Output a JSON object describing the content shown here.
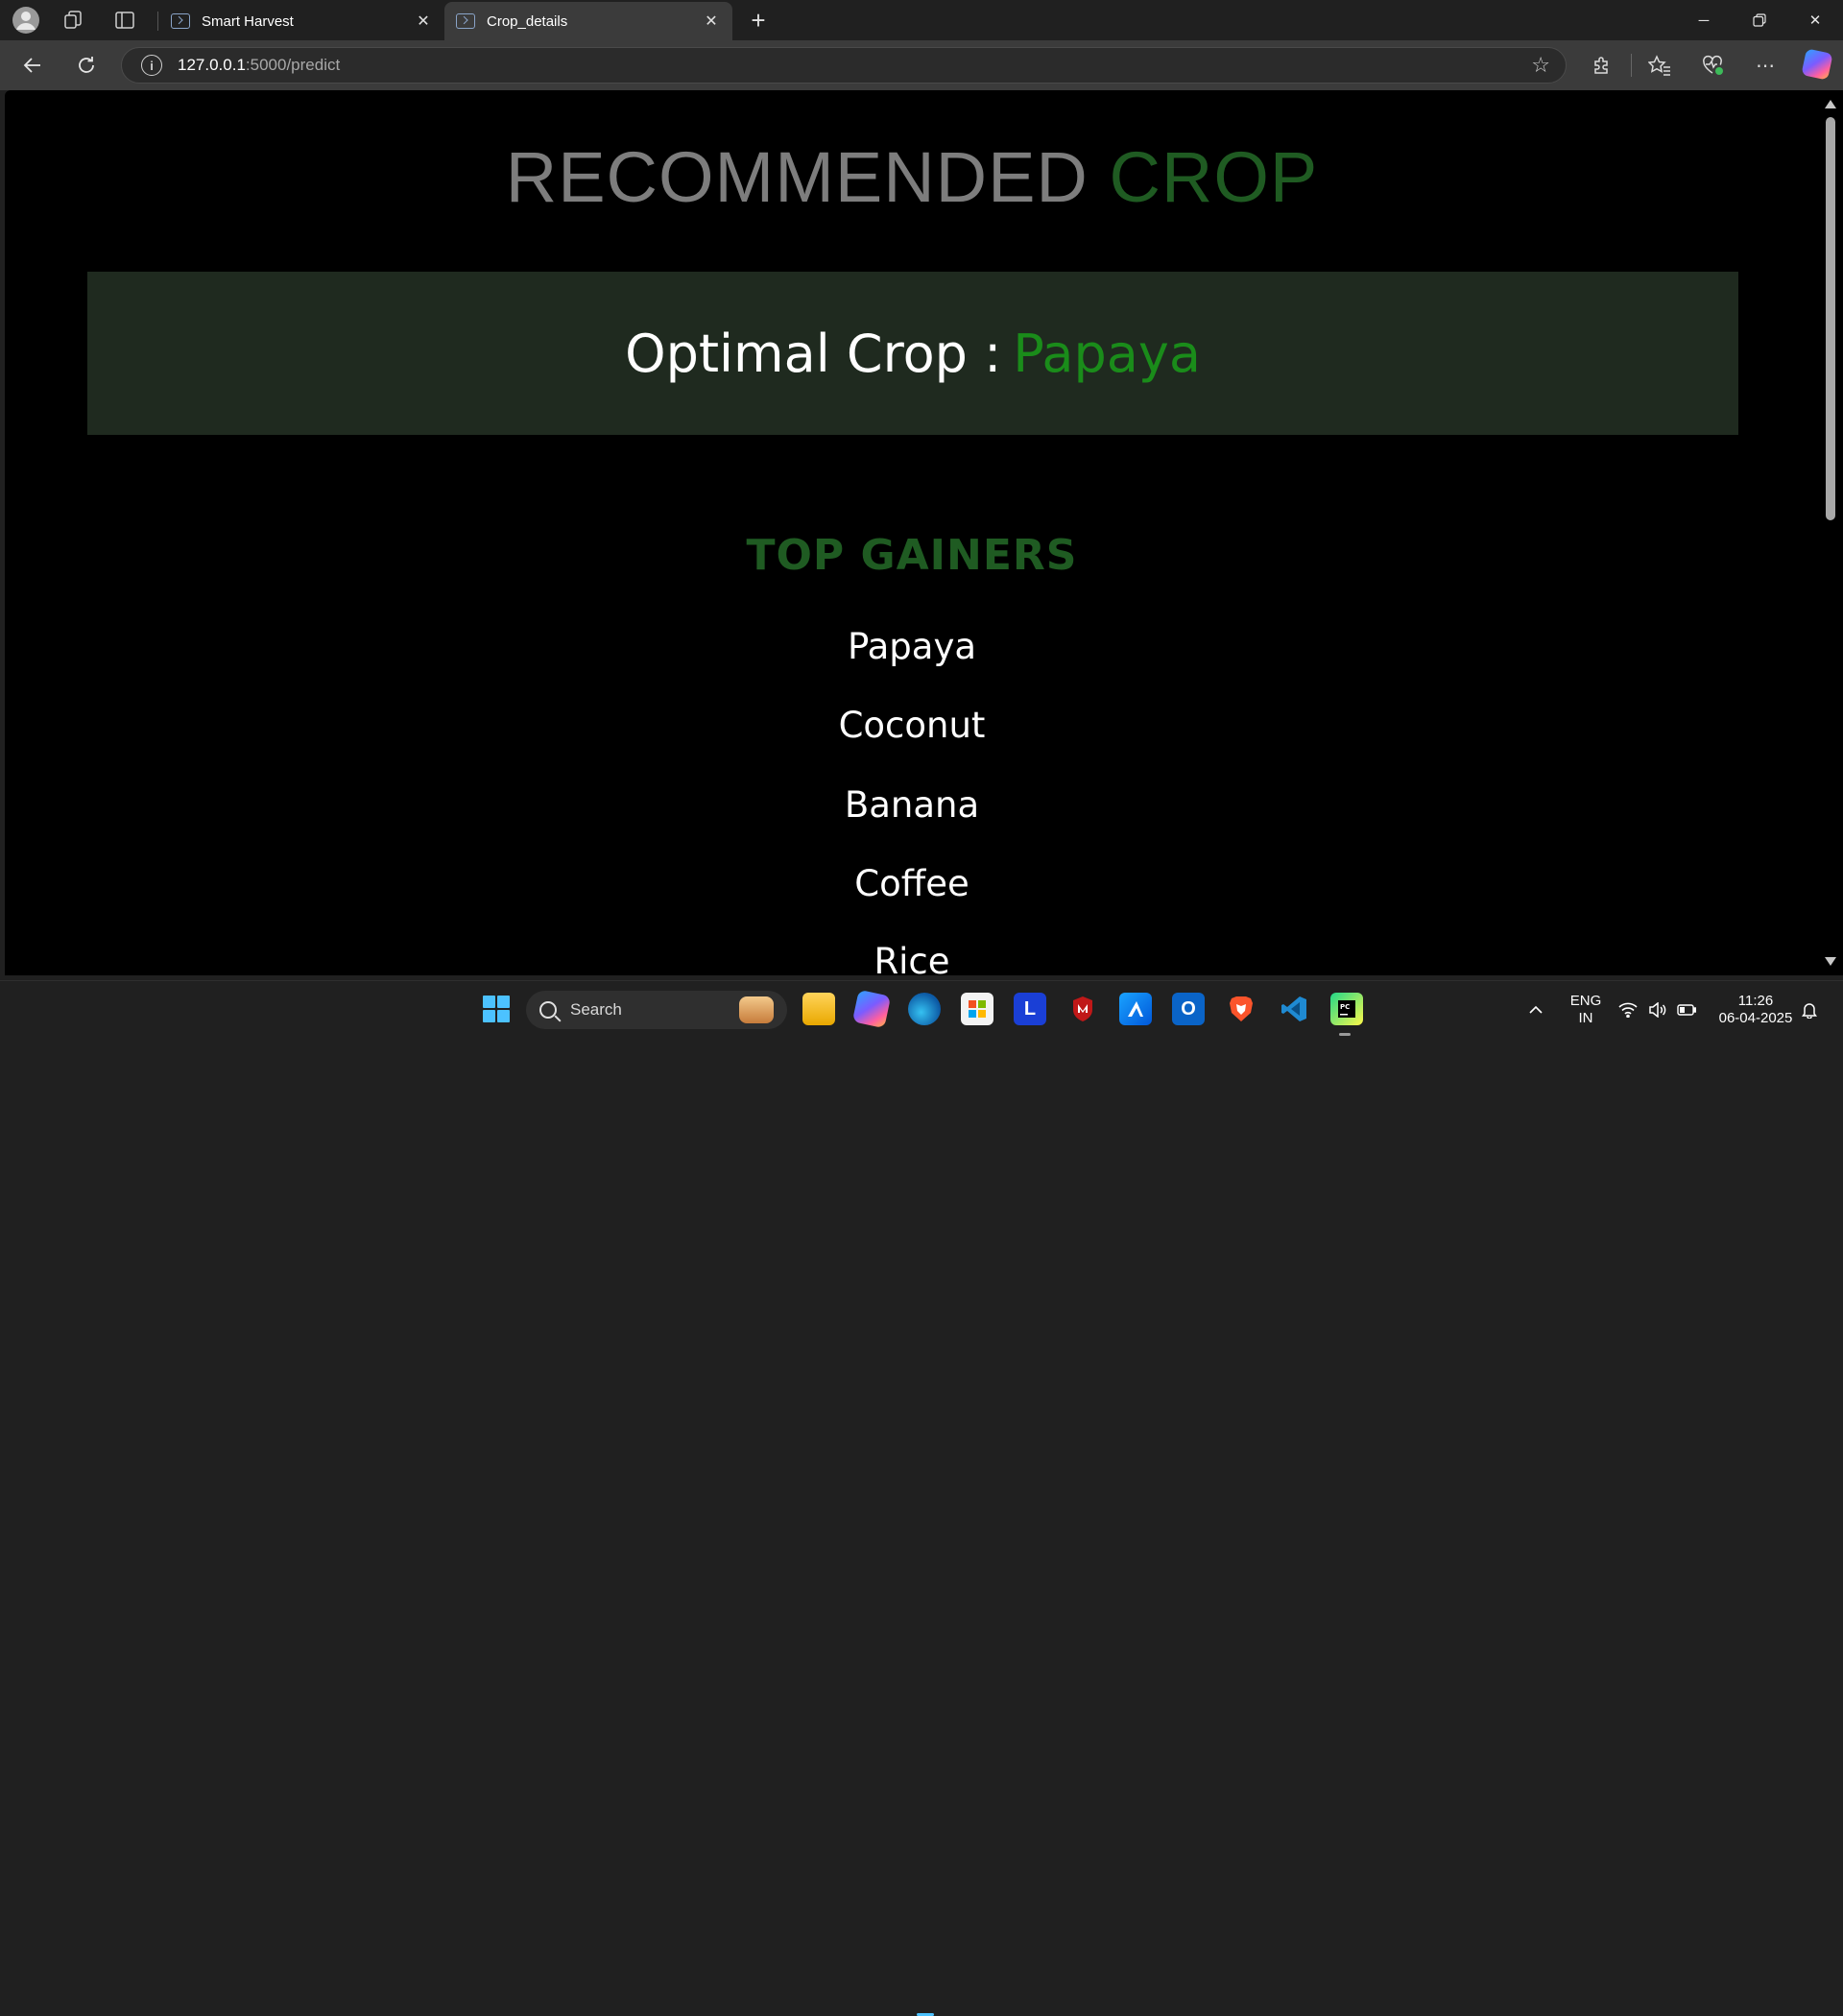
{
  "browser": {
    "tabs": [
      {
        "label": "Smart Harvest",
        "active": false
      },
      {
        "label": "Crop_details",
        "active": true
      }
    ],
    "url_host": "127.0.0.1",
    "url_rest": ":5000/predict"
  },
  "page": {
    "title_part1": "RECOMMENDED",
    "title_part2": "CROP",
    "optimal_label": "Optimal Crop :",
    "optimal_value": "Papaya",
    "gainers_title": "TOP GAINERS",
    "gainers": [
      "Papaya",
      "Coconut",
      "Banana",
      "Coffee",
      "Rice"
    ]
  },
  "taskbar": {
    "search_label": "Search",
    "lang_top": "ENG",
    "lang_bottom": "IN",
    "time": "11:26",
    "date": "06-04-2025"
  },
  "colors": {
    "accent_green": "#1a8c1a",
    "dark_green": "#1f5b22",
    "box_bg": "#1f2a1f"
  }
}
